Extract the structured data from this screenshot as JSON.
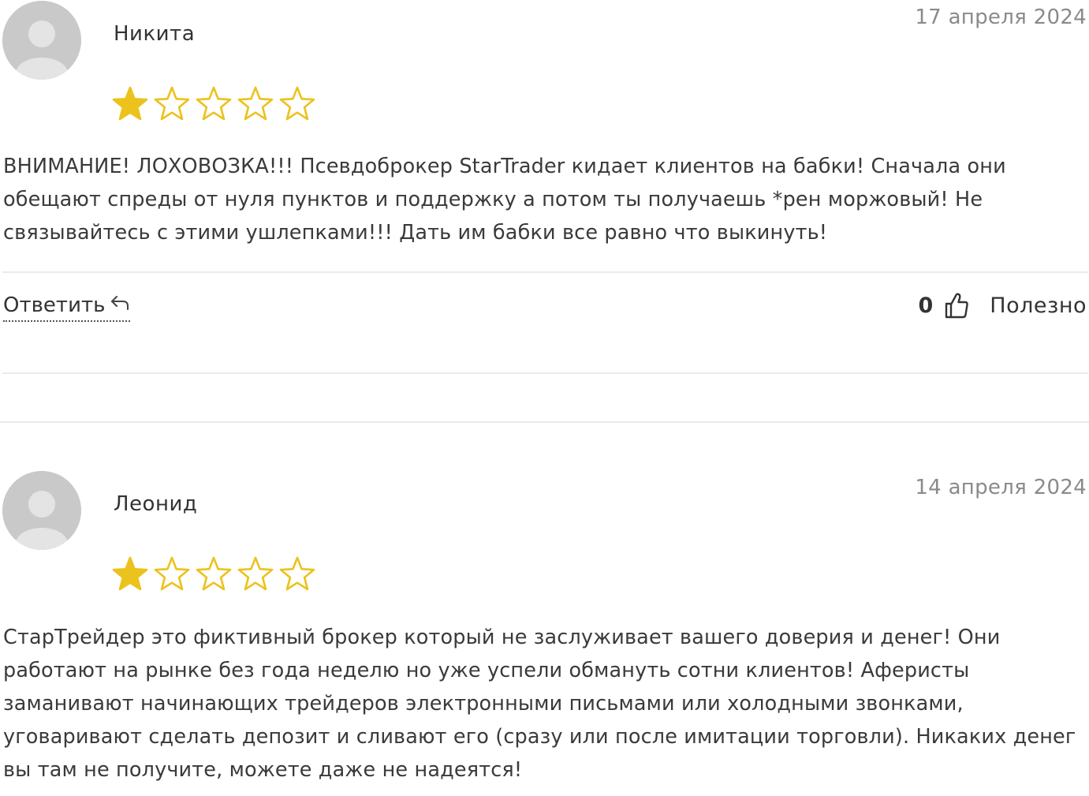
{
  "reviews": [
    {
      "author": "Никита",
      "date": "17 апреля 2024",
      "rating": 1,
      "rating_max": 5,
      "text": "ВНИМАНИЕ! ЛОХОВОЗКА!!! Псевдоброкер StarTrader кидает клиентов на бабки! Сначала они обещают спреды от нуля пунктов и поддержку а потом ты получаешь *рен моржовый! Не связывайтесь с этими ушлепками!!! Дать им бабки все равно что выкинуть!",
      "reply_label": "Ответить",
      "helpful_count": "0",
      "helpful_label": "Полезно"
    },
    {
      "author": "Леонид",
      "date": "14 апреля 2024",
      "rating": 1,
      "rating_max": 5,
      "text": "СтарТрейдер это фиктивный брокер который не заслуживает вашего доверия и денег! Они работают на рынке без года неделю но уже успели обмануть сотни клиентов! Аферисты заманивают начинающих трейдеров электронными письмами или холодными звонками, уговаривают сделать депозит и сливают его (сразу или после имитации торговли). Никаких денег вы там не получите, можете даже не надеятся!"
    }
  ],
  "colors": {
    "star_filled": "#ecc21c",
    "star_empty_stroke": "#ecc21c",
    "date_text": "#8a8a8a",
    "avatar_bg": "#c9c9c9",
    "divider": "#ebebeb"
  },
  "icons": {
    "avatar": "user-silhouette-icon",
    "star_filled": "star-filled-icon",
    "star_empty": "star-outline-icon",
    "reply": "reply-arrow-icon",
    "like": "thumbs-up-icon"
  }
}
